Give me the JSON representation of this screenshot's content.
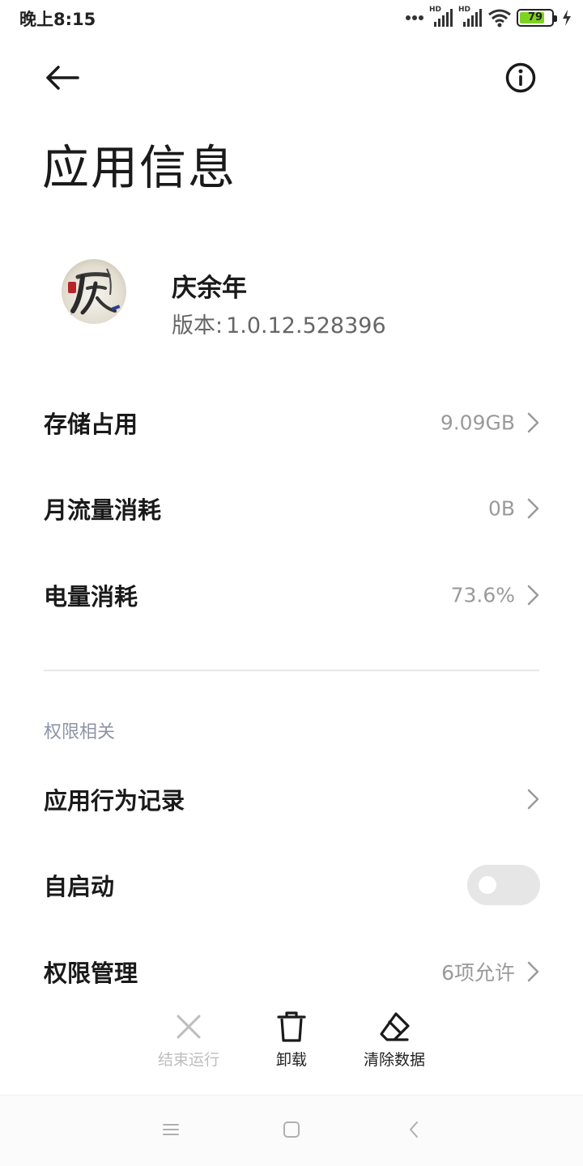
{
  "status_bar": {
    "time": "晚上8:15",
    "network_label_1": "HD",
    "network_label_2": "HD",
    "battery_level": 79,
    "battery_text": "79",
    "icons": [
      "more-dots-icon",
      "signal-icon",
      "signal-icon",
      "wifi-icon",
      "battery-icon",
      "charging-icon"
    ]
  },
  "header": {
    "back_icon": "arrow-left-icon",
    "info_icon": "info-icon",
    "title": "应用信息"
  },
  "app": {
    "name": "庆余年",
    "version_label": "版本:",
    "version": "1.0.12.528396"
  },
  "info_rows": [
    {
      "label": "存储占用",
      "value": "9.09GB"
    },
    {
      "label": "月流量消耗",
      "value": "0B"
    },
    {
      "label": "电量消耗",
      "value": "73.6%"
    }
  ],
  "permissions": {
    "section_title": "权限相关",
    "behavior_label": "应用行为记录",
    "autostart_label": "自启动",
    "autostart_enabled": false,
    "manage_label": "权限管理",
    "manage_value": "6项允许"
  },
  "actions": {
    "force_stop": "结束运行",
    "uninstall": "卸载",
    "clear_data": "清除数据"
  },
  "nav": {
    "icons": [
      "menu-icon",
      "home-icon",
      "back-icon"
    ]
  },
  "colors": {
    "battery_fill": "#7ed321",
    "secondary_text": "#9a9a9a",
    "section_header": "#8c94a6",
    "toggle_off": "#e6e6e6"
  }
}
